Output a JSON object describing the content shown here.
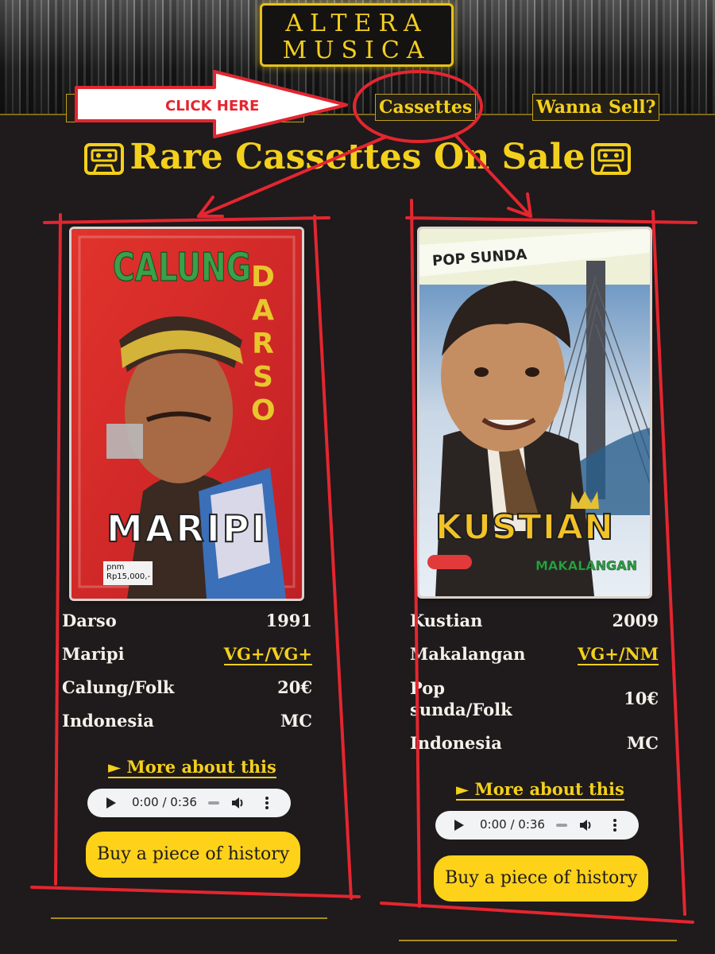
{
  "header": {
    "logo_line1": "ALTERA",
    "logo_line2": "MUSICA",
    "nav": {
      "cassettes": "Cassettes",
      "sell": "Wanna Sell?"
    }
  },
  "page_title": "Rare Cassettes On Sale",
  "annotation": {
    "label": "CLICK HERE",
    "color": "#e32630"
  },
  "products": [
    {
      "artist": "Darso",
      "year": "1991",
      "title": "Maripi",
      "condition": "VG+/VG+",
      "genre": "Calung/Folk",
      "price": "20€",
      "country": "Indonesia",
      "format": "MC",
      "cover": {
        "top_text": "CALUNG",
        "side_text": "DARSO",
        "bottom_text": "MARIPI",
        "sticker_line1": "pnm",
        "sticker_line2": "Rp15,000,-"
      },
      "more_label": "► More about this",
      "audio_time": "0:00 / 0:36",
      "buy_label": "Buy a piece of history"
    },
    {
      "artist": "Kustian",
      "year": "2009",
      "title": "Makalangan",
      "condition": "VG+/NM",
      "genre": "Pop sunda/Folk",
      "price": "10€",
      "country": "Indonesia",
      "format": "MC",
      "cover": {
        "top_text": "POP SUNDA",
        "name_text": "KUSTIAN",
        "sub_text": "MAKALANGAN"
      },
      "more_label": "► More about this",
      "audio_time": "0:00 / 0:36",
      "buy_label": "Buy a piece of history"
    }
  ],
  "colors": {
    "accent": "#f3d01c",
    "background": "#1f1a1b",
    "button": "#ffd21a"
  }
}
